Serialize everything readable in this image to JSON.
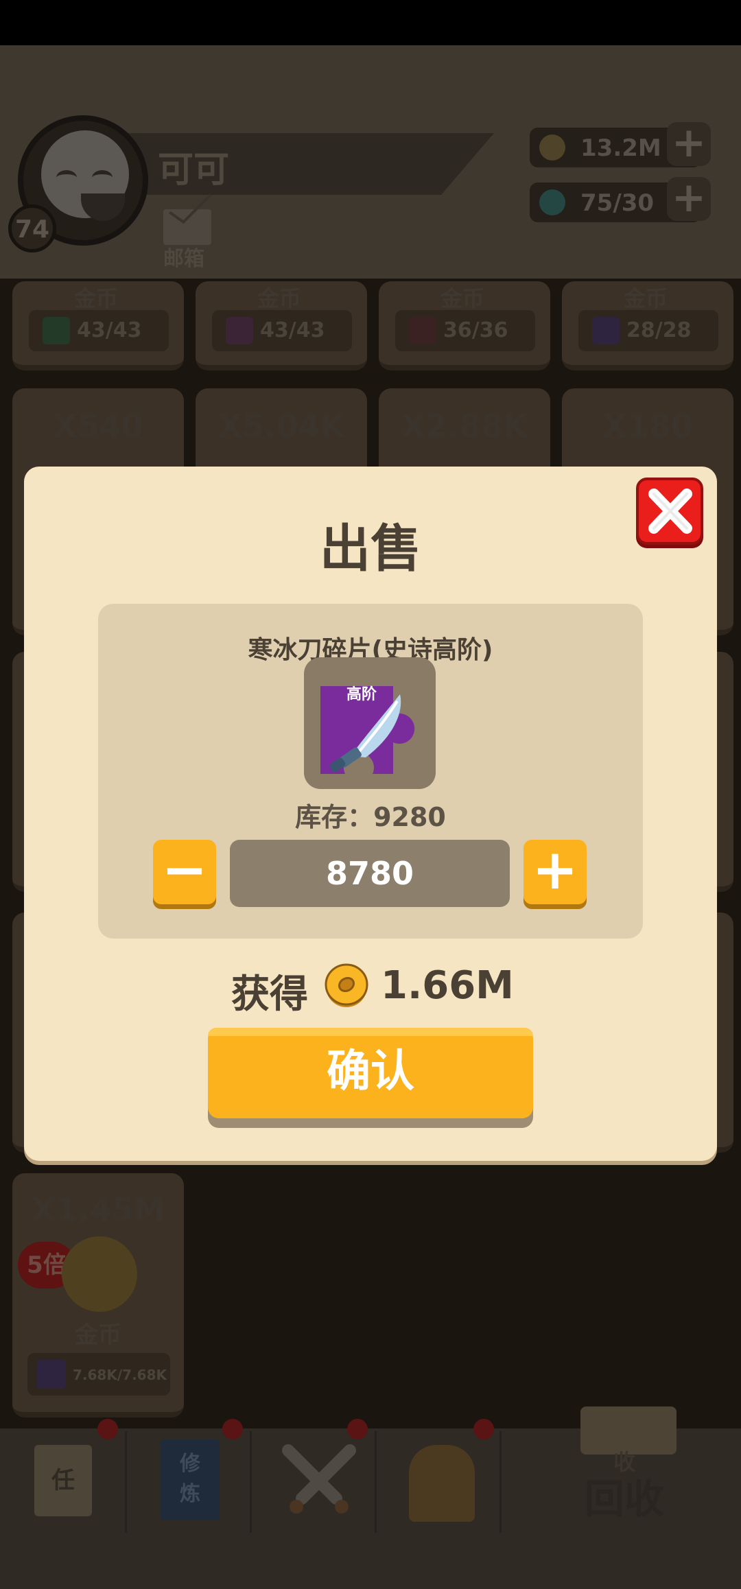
{
  "header": {
    "player_name": "可可",
    "level": "74",
    "mail_label": "邮箱",
    "gold": "13.2M",
    "gems": "75/30",
    "plus": "+"
  },
  "grid": {
    "row1": [
      {
        "label": "金币",
        "progress": "43/43"
      },
      {
        "label": "金币",
        "progress": "43/43"
      },
      {
        "label": "金币",
        "progress": "36/36"
      },
      {
        "label": "金币",
        "progress": "28/28"
      }
    ],
    "row2": [
      {
        "multiplier": "X540"
      },
      {
        "multiplier": "X5.04K"
      },
      {
        "multiplier": "X2.88K"
      },
      {
        "multiplier": "X180"
      }
    ],
    "last_card": {
      "multiplier": "X1.45M",
      "badge": "5倍",
      "label": "金币",
      "progress": "7.68K/7.68K"
    }
  },
  "bottom_nav": {
    "task": "任",
    "cultivate_top": "修",
    "cultivate_bottom": "炼",
    "recycle_small": "收",
    "recycle": "回收"
  },
  "dialog": {
    "title": "出售",
    "item_name": "寒冰刀碎片(史诗高阶)",
    "item_tag": "高阶",
    "stock": "库存：9280",
    "quantity": "8780",
    "minus": "−",
    "plus": "+",
    "gain_label": "获得",
    "gain_value": "1.66M",
    "confirm": "确认"
  },
  "colors": {
    "accent": "#fbb21d",
    "close": "#ea1f1c",
    "dialog_bg": "#f6e5c3",
    "panel_bg": "#e0cfaf"
  }
}
